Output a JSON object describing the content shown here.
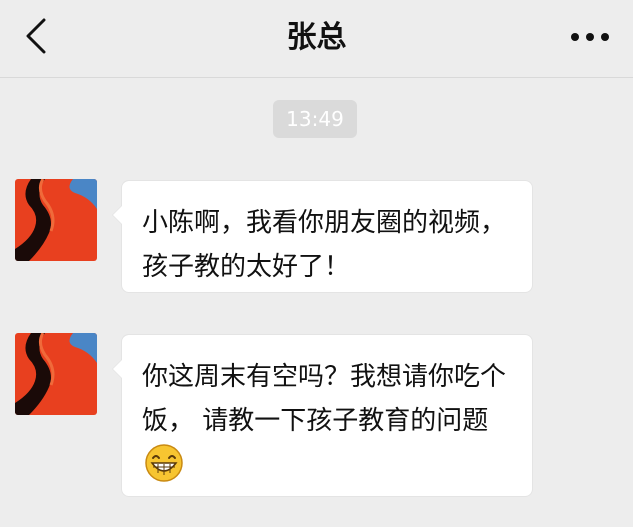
{
  "header": {
    "title": "张总",
    "back_icon": "chevron-left-icon",
    "more_icon": "more-horizontal-icon"
  },
  "chat": {
    "timestamp": "13:49",
    "messages": [
      {
        "sender": "张总",
        "text": "小陈啊，我看你朋友圈的视频，孩子教的太好了！"
      },
      {
        "sender": "张总",
        "text": "你这周末有空吗？我想请你吃个饭， 请教一下孩子教育的问题",
        "emoji": "grinning-face-icon"
      }
    ]
  },
  "colors": {
    "background": "#ededed",
    "bubble": "#ffffff",
    "timestamp_bg": "#dadada",
    "avatar_red": "#e8401f"
  }
}
